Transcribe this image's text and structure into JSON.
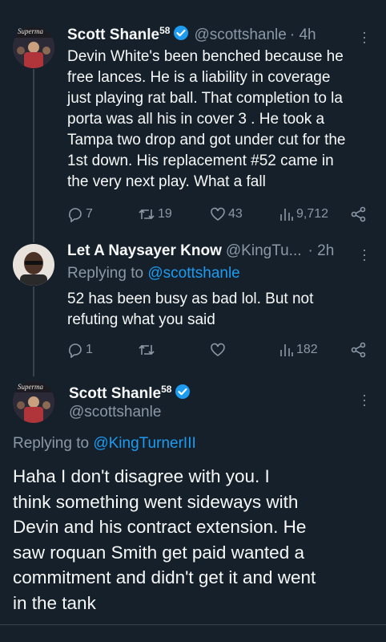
{
  "tweet1": {
    "avatar_label": "Superma",
    "name": "Scott Shanle",
    "name_sup": "58",
    "handle": "@scottshanle",
    "time": "· 4h",
    "lines": [
      "Devin White's been benched because he",
      "free lances. He is a liability in coverage",
      "just playing rat ball. That completion to la",
      "porta was all his in cover 3 . He took a",
      "Tampa two drop and got under cut for the",
      "1st down. His replacement #52 came in",
      "the very next play. What a fall"
    ],
    "replies": "7",
    "retweets": "19",
    "likes": "43",
    "views": "9,712"
  },
  "tweet2": {
    "name": "Let A Naysayer Know",
    "handle": "@KingTu...",
    "time": "· 2h",
    "replying_prefix": "Replying to ",
    "replying_handle": "@scottshanle",
    "lines": [
      "52 has been busy as bad lol. But not",
      "refuting what you said"
    ],
    "replies": "1",
    "views": "182"
  },
  "tweet3": {
    "avatar_label": "Superma",
    "name": "Scott Shanle",
    "name_sup": "58",
    "handle": "@scottshanle",
    "replying_prefix": "Replying to ",
    "replying_handle": "@KingTurnerIII",
    "lines": [
      "Haha I don't disagree with you. I",
      "think something went sideways with",
      "Devin and his contract extension. He",
      "saw roquan Smith get paid wanted a",
      "commitment and didn't get it and went",
      "in the tank"
    ]
  },
  "colors": {
    "background": "#15202b",
    "text": "#f7f9f9",
    "secondary": "#8b98a5",
    "accent": "#1d9bf0",
    "divider": "#38444d"
  },
  "icons": [
    "more-icon",
    "verified-icon",
    "reply-icon",
    "retweet-icon",
    "like-icon",
    "views-icon",
    "share-icon"
  ]
}
